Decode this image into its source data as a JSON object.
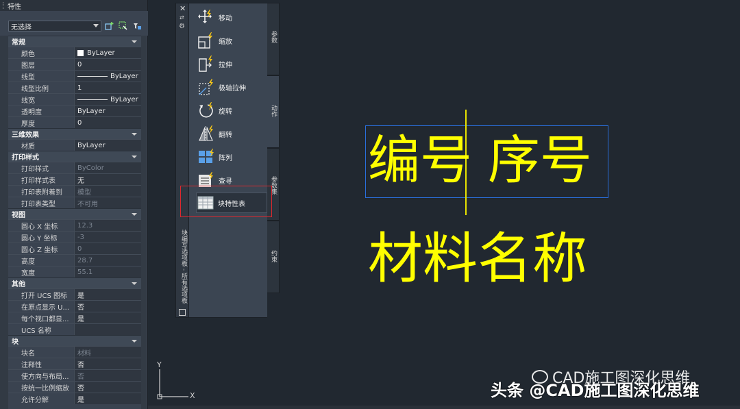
{
  "properties": {
    "title": "特性",
    "selection": "无选择",
    "sections": [
      {
        "name": "常规",
        "rows": [
          {
            "key": "颜色",
            "value": "ByLayer",
            "swatch": "#ffffff"
          },
          {
            "key": "图层",
            "value": "0"
          },
          {
            "key": "线型",
            "value": "ByLayer",
            "line": true
          },
          {
            "key": "线型比例",
            "value": "1"
          },
          {
            "key": "线宽",
            "value": "ByLayer",
            "line": true
          },
          {
            "key": "透明度",
            "value": "ByLayer"
          },
          {
            "key": "厚度",
            "value": "0"
          }
        ]
      },
      {
        "name": "三维效果",
        "rows": [
          {
            "key": "材质",
            "value": "ByLayer"
          }
        ]
      },
      {
        "name": "打印样式",
        "rows": [
          {
            "key": "打印样式",
            "value": "ByColor",
            "dim": true
          },
          {
            "key": "打印样式表",
            "value": "无"
          },
          {
            "key": "打印表附着到",
            "value": "模型",
            "dim": true
          },
          {
            "key": "打印表类型",
            "value": "不可用",
            "dim": true
          }
        ]
      },
      {
        "name": "视图",
        "rows": [
          {
            "key": "圆心 X 坐标",
            "value": "12.3",
            "dim": true
          },
          {
            "key": "圆心 Y 坐标",
            "value": "-3",
            "dim": true
          },
          {
            "key": "圆心 Z 坐标",
            "value": "0",
            "dim": true
          },
          {
            "key": "高度",
            "value": "28.7",
            "dim": true
          },
          {
            "key": "宽度",
            "value": "55.1",
            "dim": true
          }
        ]
      },
      {
        "name": "其他",
        "rows": [
          {
            "key": "打开 UCS 图标",
            "value": "是"
          },
          {
            "key": "在原点显示 U...",
            "value": "否"
          },
          {
            "key": "每个视口都显...",
            "value": "是"
          },
          {
            "key": "UCS 名称",
            "value": ""
          }
        ]
      },
      {
        "name": "块",
        "rows": [
          {
            "key": "块名",
            "value": "材料",
            "dim": true
          },
          {
            "key": "注释性",
            "value": "否"
          },
          {
            "key": "使方向与布局...",
            "value": "否",
            "dim": true
          },
          {
            "key": "按统一比例缩放",
            "value": "否"
          },
          {
            "key": "允许分解",
            "value": "是"
          }
        ]
      }
    ]
  },
  "palette": {
    "title": "块编写选项板 - 所有选项板",
    "tools": [
      {
        "label": "移动",
        "icon": "move-icon"
      },
      {
        "label": "缩放",
        "icon": "scale-icon"
      },
      {
        "label": "拉伸",
        "icon": "stretch-icon"
      },
      {
        "label": "极轴拉伸",
        "icon": "polar-stretch-icon"
      },
      {
        "label": "旋转",
        "icon": "rotate-icon"
      },
      {
        "label": "翻转",
        "icon": "flip-icon"
      },
      {
        "label": "阵列",
        "icon": "array-icon"
      },
      {
        "label": "查寻",
        "icon": "lookup-icon"
      },
      {
        "label": "块特性表",
        "icon": "block-table-icon"
      }
    ],
    "tabs": [
      "参数",
      "动作",
      "参数集",
      "约束"
    ]
  },
  "drawing": {
    "text1": "编号",
    "text2": "序号",
    "text3": "材料名称",
    "ucs_x": "X",
    "ucs_y": "Y"
  },
  "watermark": {
    "line1": "CAD施工图深化思维",
    "line2": "头条 @CAD施工图深化思维"
  }
}
